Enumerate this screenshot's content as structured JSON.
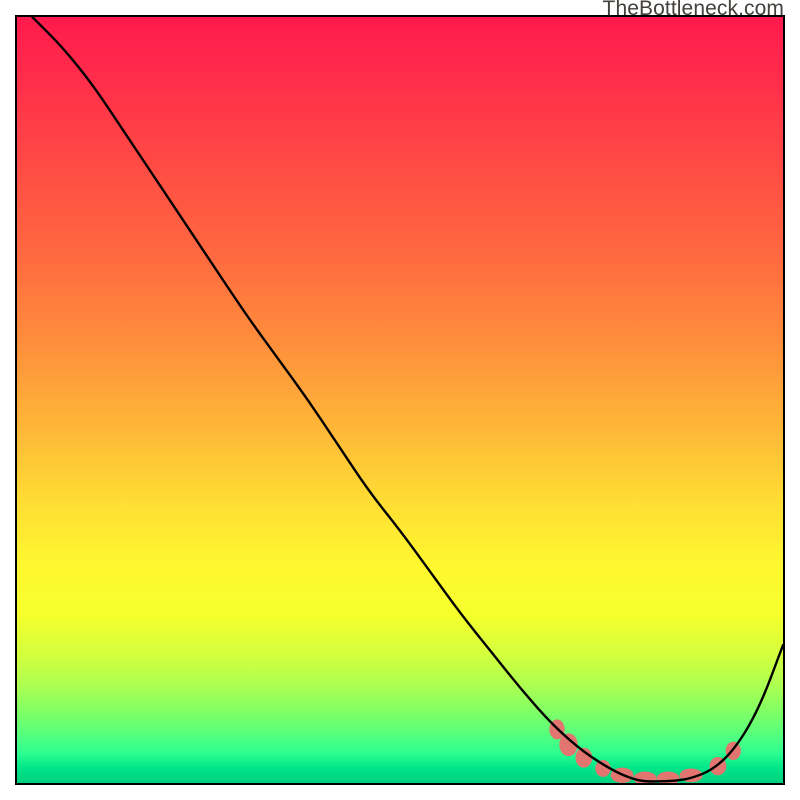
{
  "watermark": "TheBottleneck.com",
  "chart_data": {
    "type": "line",
    "title": "",
    "xlabel": "",
    "ylabel": "",
    "xlim": [
      0,
      100
    ],
    "ylim": [
      0,
      100
    ],
    "grid": false,
    "legend": false,
    "background_gradient": {
      "direction": "vertical",
      "stops": [
        {
          "pos": 0,
          "color": "#ff1a4d"
        },
        {
          "pos": 50,
          "color": "#ffd633"
        },
        {
          "pos": 80,
          "color": "#f5ff2c"
        },
        {
          "pos": 100,
          "color": "#00d080"
        }
      ]
    },
    "series": [
      {
        "name": "bottleneck-curve",
        "color": "#000000",
        "x": [
          2,
          6,
          10,
          14,
          18,
          22,
          26,
          30,
          34,
          38,
          42,
          46,
          50,
          54,
          58,
          62,
          66,
          70,
          74,
          78,
          80.5,
          82,
          84,
          86,
          88,
          91,
          94,
          97,
          100
        ],
        "y": [
          100,
          96,
          91,
          85,
          79,
          73,
          67,
          61,
          55.5,
          50,
          44,
          38,
          33,
          27.5,
          22,
          17,
          12,
          7.5,
          4,
          1.5,
          0.5,
          0.2,
          0.2,
          0.3,
          0.6,
          1.8,
          4.8,
          10,
          18
        ]
      }
    ],
    "markers": [
      {
        "name": "highlight-dots",
        "color": "#e2756f",
        "shape": "capsule",
        "points": [
          {
            "x": 70.5,
            "y": 7.0,
            "w": 2.0,
            "h": 2.6
          },
          {
            "x": 72.0,
            "y": 5.0,
            "w": 2.4,
            "h": 3.0
          },
          {
            "x": 74.0,
            "y": 3.3,
            "w": 2.2,
            "h": 2.6
          },
          {
            "x": 76.5,
            "y": 1.9,
            "w": 2.0,
            "h": 2.2
          },
          {
            "x": 79.0,
            "y": 1.0,
            "w": 3.0,
            "h": 2.0
          },
          {
            "x": 82.0,
            "y": 0.6,
            "w": 3.0,
            "h": 1.8
          },
          {
            "x": 85.0,
            "y": 0.6,
            "w": 3.0,
            "h": 1.8
          },
          {
            "x": 88.0,
            "y": 1.0,
            "w": 3.0,
            "h": 1.8
          },
          {
            "x": 91.5,
            "y": 2.2,
            "w": 2.2,
            "h": 2.4
          },
          {
            "x": 93.5,
            "y": 4.2,
            "w": 2.0,
            "h": 2.4
          }
        ]
      }
    ]
  }
}
